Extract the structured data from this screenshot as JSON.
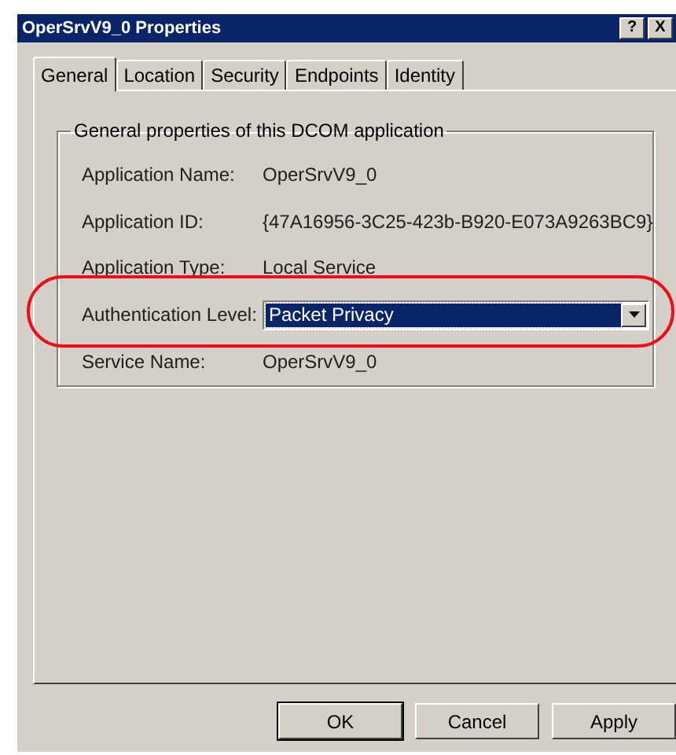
{
  "window": {
    "title": "OperSrvV9_0 Properties",
    "title_buttons": [
      "?",
      "X"
    ]
  },
  "tabs": [
    {
      "label": "General",
      "selected": true
    },
    {
      "label": "Location",
      "selected": false
    },
    {
      "label": "Security",
      "selected": false
    },
    {
      "label": "Endpoints",
      "selected": false
    },
    {
      "label": "Identity",
      "selected": false
    }
  ],
  "group": {
    "title": "General properties of this DCOM application",
    "rows": [
      {
        "kind": "text",
        "label": "Application Name:",
        "value": "OperSrvV9_0",
        "highlighted": false
      },
      {
        "kind": "text",
        "label": "Application ID:",
        "value": "{47A16956-3C25-423b-B920-E073A9263BC9}",
        "highlighted": false
      },
      {
        "kind": "text",
        "label": "Application Type:",
        "value": "Local Service",
        "highlighted": false
      },
      {
        "kind": "dropdown",
        "label": "Authentication Level:",
        "value": "Packet Privacy",
        "focused": true,
        "highlighted": true
      },
      {
        "kind": "text",
        "label": "Service Name:",
        "value": "OperSrvV9_0",
        "highlighted": false
      }
    ]
  },
  "buttons": [
    {
      "label": "OK",
      "default": true
    },
    {
      "label": "Cancel",
      "default": false
    },
    {
      "label": "Apply",
      "default": false
    }
  ]
}
